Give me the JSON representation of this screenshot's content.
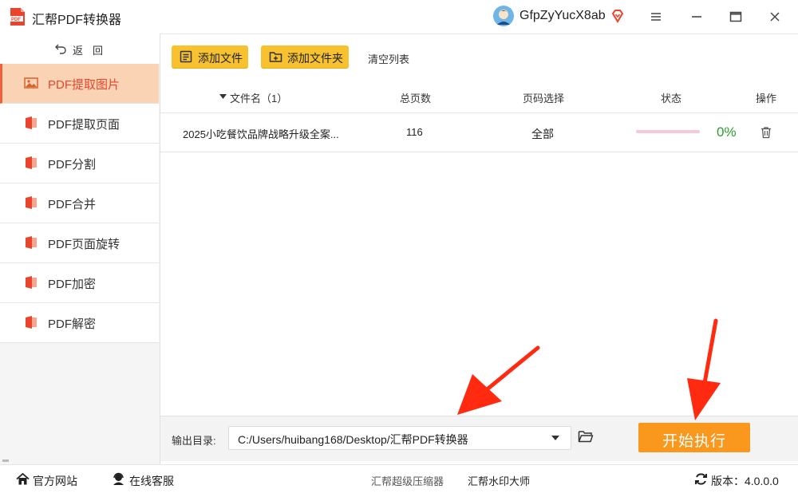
{
  "app": {
    "title": "汇帮PDF转换器",
    "logo_text": "PDF"
  },
  "account": {
    "username": "GfpZyYucX8ab"
  },
  "sidebar": {
    "back_label": "返回",
    "items": [
      {
        "label": "PDF提取图片",
        "active": true
      },
      {
        "label": "PDF提取页面"
      },
      {
        "label": "PDF分割"
      },
      {
        "label": "PDF合并"
      },
      {
        "label": "PDF页面旋转"
      },
      {
        "label": "PDF加密"
      },
      {
        "label": "PDF解密"
      }
    ]
  },
  "toolbar": {
    "add_file": "添加文件",
    "add_folder": "添加文件夹",
    "clear_list": "清空列表"
  },
  "table": {
    "headers": {
      "filename": "文件名（1）",
      "pages": "总页数",
      "page_select": "页码选择",
      "status": "状态",
      "actions": "操作"
    },
    "rows": [
      {
        "filename": "2025小吃餐饮品牌战略升级全案...",
        "pages": "116",
        "page_select": "全部",
        "progress": 0,
        "progress_text": "0%"
      }
    ]
  },
  "output": {
    "label": "输出目录:",
    "path": "C:/Users/huibang168/Desktop/汇帮PDF转换器",
    "start_label": "开始执行"
  },
  "footer": {
    "website": "官方网站",
    "support": "在线客服",
    "link1": "汇帮超级压缩器",
    "link2": "汇帮水印大师",
    "version": "版本：4.0.0.0"
  },
  "colors": {
    "accent": "#f9981c",
    "active_bg": "#fad2b4",
    "active_text": "#e8452c",
    "toolbar_button": "#f7c12f",
    "progress_track": "#f8c9d6",
    "status_ok": "#2e9d2e",
    "annotation_arrow": "#ff2a10"
  },
  "icons": {
    "sidebar": [
      "image-icon",
      "pdf-file-icon"
    ],
    "toolbar": [
      "add-file-icon",
      "add-folder-icon"
    ],
    "window": [
      "menu-icon",
      "minimize-icon",
      "maximize-icon",
      "close-icon"
    ],
    "footer": [
      "home-icon",
      "customer-service-icon",
      "refresh-icon"
    ]
  }
}
